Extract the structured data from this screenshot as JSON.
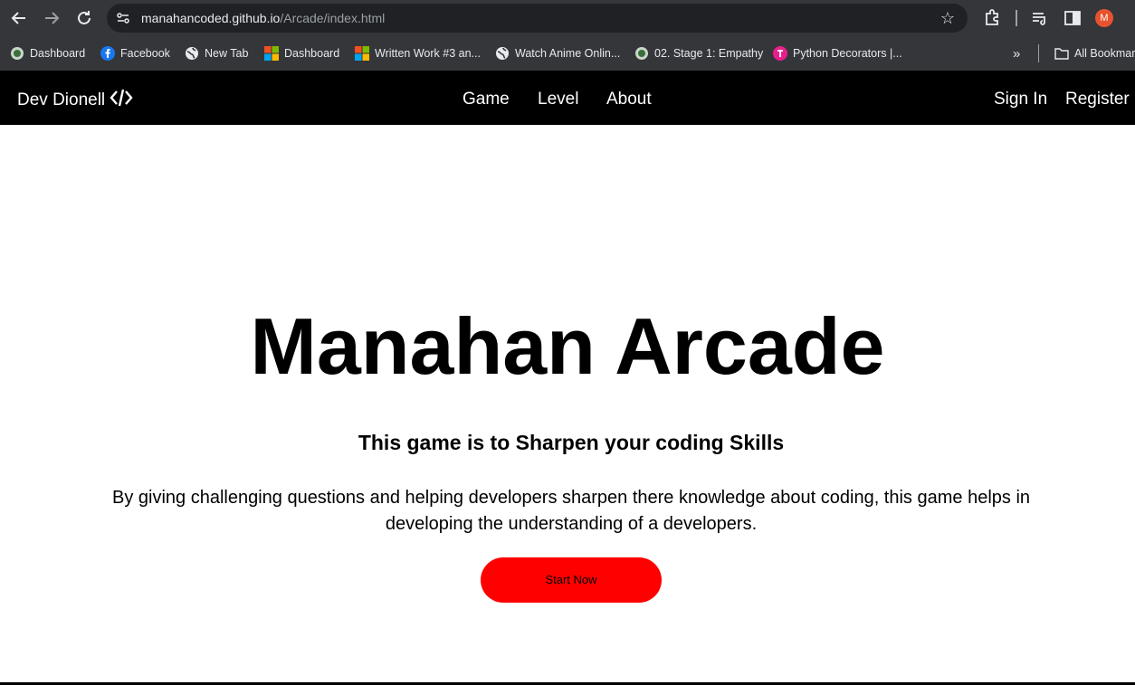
{
  "browser": {
    "url_domain": "manahancoded.github.io",
    "url_path": "/Arcade/index.html",
    "profile_initial": "M"
  },
  "bookmarks": [
    {
      "label": "Dashboard",
      "icon": "globe-green-icon"
    },
    {
      "label": "Facebook",
      "icon": "facebook-icon"
    },
    {
      "label": "New Tab",
      "icon": "globe-icon"
    },
    {
      "label": "Dashboard",
      "icon": "microsoft-icon"
    },
    {
      "label": "Written Work #3 an...",
      "icon": "microsoft-icon"
    },
    {
      "label": "Watch Anime Onlin...",
      "icon": "globe-icon"
    },
    {
      "label": "02. Stage 1: Empathy",
      "icon": "globe-green-icon"
    },
    {
      "label": "Python Decorators |...",
      "icon": "pink-t-icon"
    }
  ],
  "bookmarks_overflow": "»",
  "all_bookmarks_label": "All Bookmar",
  "site": {
    "brand": "Dev Dionell",
    "brand_icon": "code-icon",
    "nav": [
      "Game",
      "Level",
      "About"
    ],
    "sign_in": "Sign In",
    "register": "Register"
  },
  "hero": {
    "title": "Manahan Arcade",
    "subtitle": "This game is to Sharpen your coding Skills",
    "description": "By giving challenging questions and helping developers sharpen there knowledge about coding, this game helps in developing the understanding of a developers.",
    "cta": "Start Now"
  },
  "colors": {
    "chrome_bg": "#35363a",
    "omnibox_bg": "#202124",
    "nav_bg": "#000000",
    "cta_bg": "#ff0000",
    "avatar_bg": "#e8532f"
  }
}
